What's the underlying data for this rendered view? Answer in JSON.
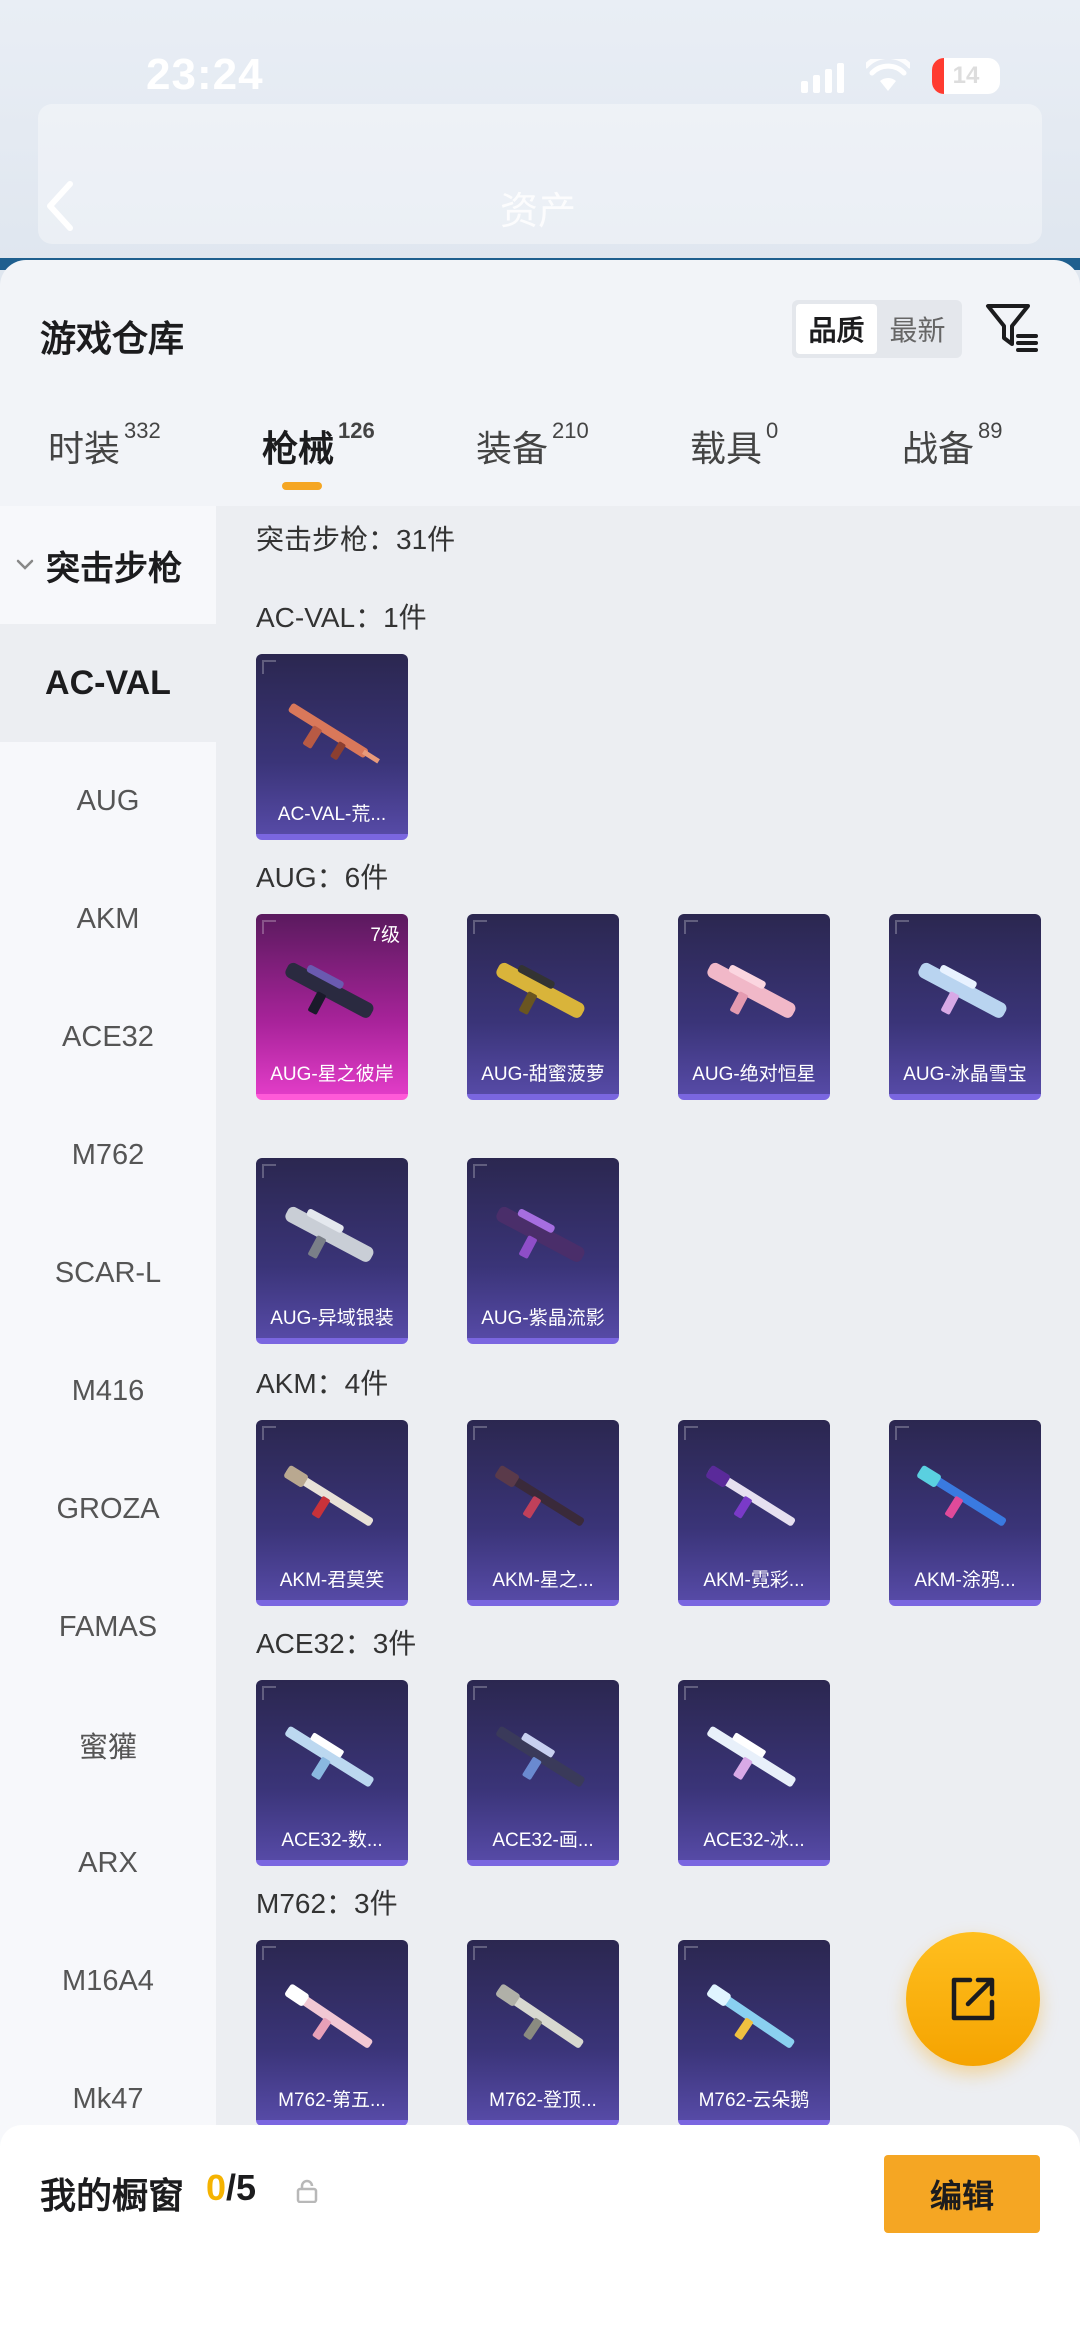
{
  "status_bar": {
    "time": "23:24",
    "battery": "14"
  },
  "header": {
    "back_icon": "back-arrow-icon",
    "asset_label": "资产"
  },
  "sheet": {
    "title": "游戏仓库",
    "sort_options": [
      "品质",
      "最新"
    ],
    "sort_selected": "品质",
    "filter_icon": "filter-icon"
  },
  "tabs": [
    {
      "label": "时装",
      "count": "332"
    },
    {
      "label": "枪械",
      "count": "126",
      "active": true
    },
    {
      "label": "装备",
      "count": "210"
    },
    {
      "label": "载具",
      "count": "0"
    },
    {
      "label": "战备",
      "count": "89"
    }
  ],
  "sidebar": {
    "group": "突击步枪",
    "items": [
      "AC-VAL",
      "AUG",
      "AKM",
      "ACE32",
      "M762",
      "SCAR-L",
      "M416",
      "GROZA",
      "FAMAS",
      "蜜獾",
      "ARX",
      "M16A4",
      "Mk47"
    ],
    "active": "AC-VAL"
  },
  "content": {
    "heading": "突击步枪：31件",
    "categories": [
      {
        "label": "AC-VAL：1件",
        "items": [
          {
            "name": "AC-VAL-荒..."
          }
        ]
      },
      {
        "label": "AUG：6件",
        "items": [
          {
            "name": "AUG-星之彼岸",
            "level": "7级",
            "tier": "pink"
          },
          {
            "name": "AUG-甜蜜菠萝"
          },
          {
            "name": "AUG-绝对恒星"
          },
          {
            "name": "AUG-冰晶雪宝"
          },
          {
            "name": "AUG-异域银装"
          },
          {
            "name": "AUG-紫晶流影"
          }
        ]
      },
      {
        "label": "AKM：4件",
        "items": [
          {
            "name": "AKM-君莫笑"
          },
          {
            "name": "AKM-星之..."
          },
          {
            "name": "AKM-霓彩..."
          },
          {
            "name": "AKM-涂鸦..."
          }
        ]
      },
      {
        "label": "ACE32：3件",
        "items": [
          {
            "name": "ACE32-数..."
          },
          {
            "name": "ACE32-画..."
          },
          {
            "name": "ACE32-冰..."
          }
        ]
      },
      {
        "label": "M762：3件",
        "items": [
          {
            "name": "M762-第五..."
          },
          {
            "name": "M762-登顶..."
          },
          {
            "name": "M762-云朵鹅"
          }
        ]
      }
    ]
  },
  "fab": {
    "icon": "share-icon"
  },
  "bottom_bar": {
    "title": "我的橱窗",
    "current": "0",
    "total": "/5",
    "lock_icon": "lock-icon",
    "edit_label": "编辑"
  },
  "colors": {
    "accent": "#f5a623",
    "card_purple": "#3a3478",
    "card_pink": "#e13cc7"
  }
}
